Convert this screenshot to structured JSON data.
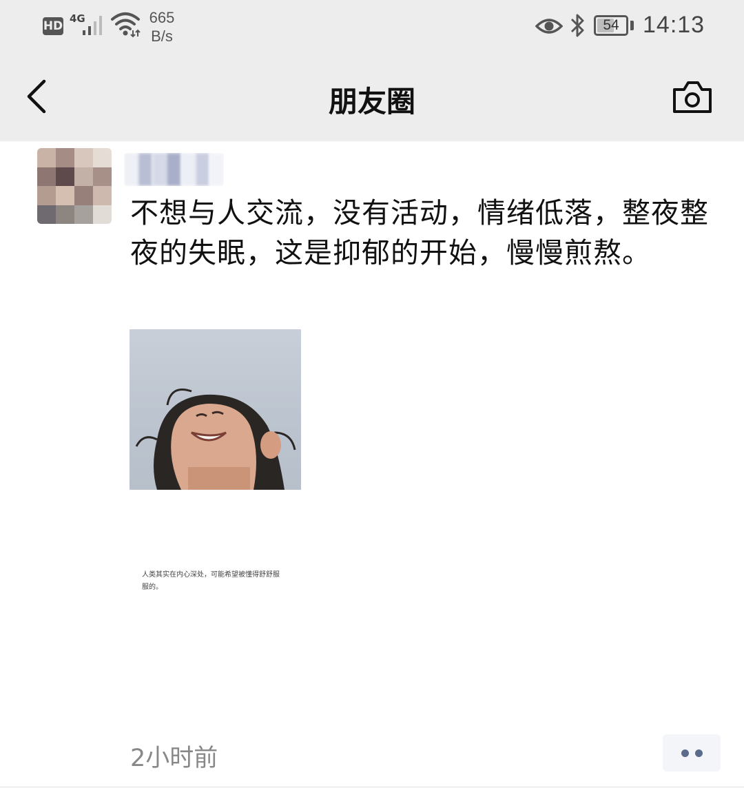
{
  "status_bar": {
    "hd_label": "HD",
    "network_type": "4G",
    "net_speed_value": "665",
    "net_speed_unit": "B/s",
    "battery_level": "54",
    "time": "14:13",
    "icons": [
      "hd-icon",
      "signal-icon",
      "wifi-icon",
      "eye-icon",
      "bluetooth-icon",
      "battery-icon"
    ]
  },
  "nav": {
    "title": "朋友圈",
    "back_icon": "chevron-left-icon",
    "camera_icon": "camera-icon"
  },
  "post": {
    "text": "不想与人交流，没有活动，情绪低落，整夜整夜的失眠，这是抑郁的开始，慢慢煎熬。",
    "caption_line1": "人类其实在内心深处，可能希望被懂得舒舒服",
    "caption_line2": "服的。",
    "time_ago": "2小时前",
    "more_icon": "more-dots-icon"
  },
  "colors": {
    "header_bg": "#ededed",
    "accent_link": "#5b6b8c",
    "muted_text": "#888888"
  }
}
